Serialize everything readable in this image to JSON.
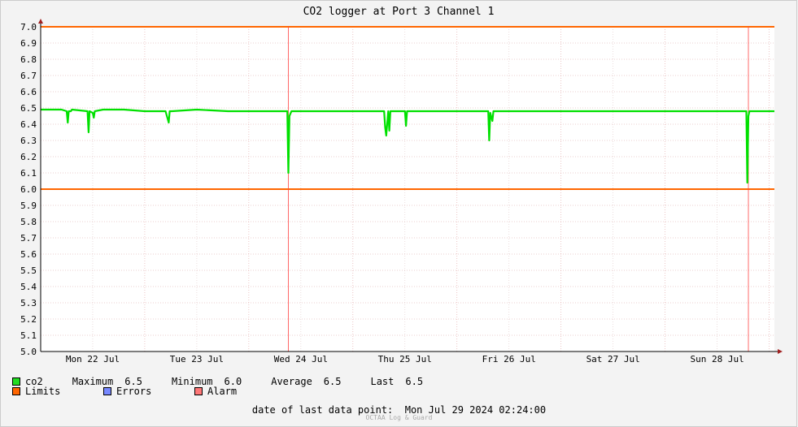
{
  "chart_data": {
    "type": "line",
    "title": "CO2 logger at Port 3 Channel 1",
    "xlabel": "",
    "ylabel": "",
    "ylim": [
      5.0,
      7.0
    ],
    "y_ticks": [
      "5.0",
      "5.1",
      "5.2",
      "5.3",
      "5.4",
      "5.5",
      "5.6",
      "5.7",
      "5.8",
      "5.9",
      "6.0",
      "6.1",
      "6.2",
      "6.3",
      "6.4",
      "6.5",
      "6.6",
      "6.7",
      "6.8",
      "6.9",
      "7.0"
    ],
    "x_range_days": [
      0,
      7.05
    ],
    "x_tick_labels": [
      "Mon 22 Jul",
      "Tue 23 Jul",
      "Wed 24 Jul",
      "Thu 25 Jul",
      "Fri 26 Jul",
      "Sat 27 Jul",
      "Sun 28 Jul"
    ],
    "x_tick_positions": [
      0.5,
      1.5,
      2.5,
      3.5,
      4.5,
      5.5,
      6.5
    ],
    "grid": true,
    "limits": {
      "upper": 7.0,
      "lower": 6.0,
      "color": "#ff6600"
    },
    "week_markers": [
      2.38,
      6.8
    ],
    "series": [
      {
        "name": "co2",
        "color": "#00e000",
        "x": [
          0,
          0.1,
          0.2,
          0.25,
          0.26,
          0.27,
          0.29,
          0.3,
          0.45,
          0.46,
          0.47,
          0.5,
          0.51,
          0.52,
          0.6,
          0.8,
          1.0,
          1.2,
          1.23,
          1.24,
          1.26,
          1.5,
          1.8,
          2.0,
          2.2,
          2.37,
          2.38,
          2.39,
          2.41,
          2.6,
          3.0,
          3.3,
          3.31,
          3.32,
          3.34,
          3.35,
          3.36,
          3.38,
          3.5,
          3.51,
          3.52,
          4.0,
          4.3,
          4.31,
          4.32,
          4.34,
          4.35,
          4.37,
          4.6,
          5.0,
          5.5,
          6.0,
          6.5,
          6.78,
          6.79,
          6.8,
          6.81,
          6.83,
          7.05
        ],
        "y": [
          6.49,
          6.49,
          6.49,
          6.48,
          6.41,
          6.48,
          6.48,
          6.49,
          6.48,
          6.35,
          6.48,
          6.47,
          6.44,
          6.48,
          6.49,
          6.49,
          6.48,
          6.48,
          6.41,
          6.48,
          6.48,
          6.49,
          6.48,
          6.48,
          6.48,
          6.48,
          6.1,
          6.45,
          6.48,
          6.48,
          6.48,
          6.48,
          6.38,
          6.33,
          6.48,
          6.36,
          6.48,
          6.48,
          6.48,
          6.39,
          6.48,
          6.48,
          6.48,
          6.3,
          6.47,
          6.42,
          6.48,
          6.48,
          6.48,
          6.48,
          6.48,
          6.48,
          6.48,
          6.48,
          6.04,
          6.45,
          6.48,
          6.48,
          6.48
        ]
      }
    ],
    "legend": {
      "co2": {
        "label": "co2",
        "color": "#22dd22"
      },
      "stats": [
        {
          "label": "Maximum",
          "value": "6.5"
        },
        {
          "label": "Minimum",
          "value": "6.0"
        },
        {
          "label": "Average",
          "value": "6.5"
        },
        {
          "label": "Last",
          "value": "6.5"
        }
      ],
      "items": [
        {
          "label": "Limits",
          "color": "#ff6600"
        },
        {
          "label": "Errors",
          "color": "#7788ff"
        },
        {
          "label": "Alarm",
          "color": "#ff7777"
        }
      ]
    }
  },
  "footer": {
    "last_data_text": "date of last data point:  Mon Jul 29 2024 02:24:00",
    "brand": "OCTAA Log & Guard"
  }
}
